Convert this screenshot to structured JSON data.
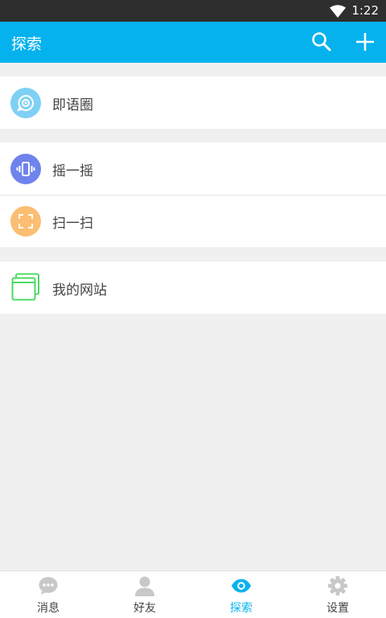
{
  "status_bar": {
    "time": "1:22"
  },
  "header": {
    "title": "探索",
    "search_icon": "search-icon",
    "add_icon": "plus-icon"
  },
  "sections": [
    {
      "items": [
        {
          "label": "即语圈",
          "icon": "moments-icon",
          "color": "#7fd0f5"
        }
      ]
    },
    {
      "items": [
        {
          "label": "摇一摇",
          "icon": "shake-icon",
          "color": "#6f83ec"
        },
        {
          "label": "扫一扫",
          "icon": "scan-icon",
          "color": "#fbbe72"
        }
      ]
    },
    {
      "items": [
        {
          "label": "我的网站",
          "icon": "website-icon",
          "color": "#4cd964"
        }
      ]
    }
  ],
  "tabs": [
    {
      "label": "消息",
      "icon": "chat-icon",
      "active": false
    },
    {
      "label": "好友",
      "icon": "user-icon",
      "active": false
    },
    {
      "label": "探索",
      "icon": "eye-icon",
      "active": true
    },
    {
      "label": "设置",
      "icon": "gear-icon",
      "active": false
    }
  ],
  "colors": {
    "primary": "#06b2ee",
    "status_bar": "#2e2e2e",
    "background": "#f0f0f0",
    "inactive_icon": "#c8c8c8"
  }
}
